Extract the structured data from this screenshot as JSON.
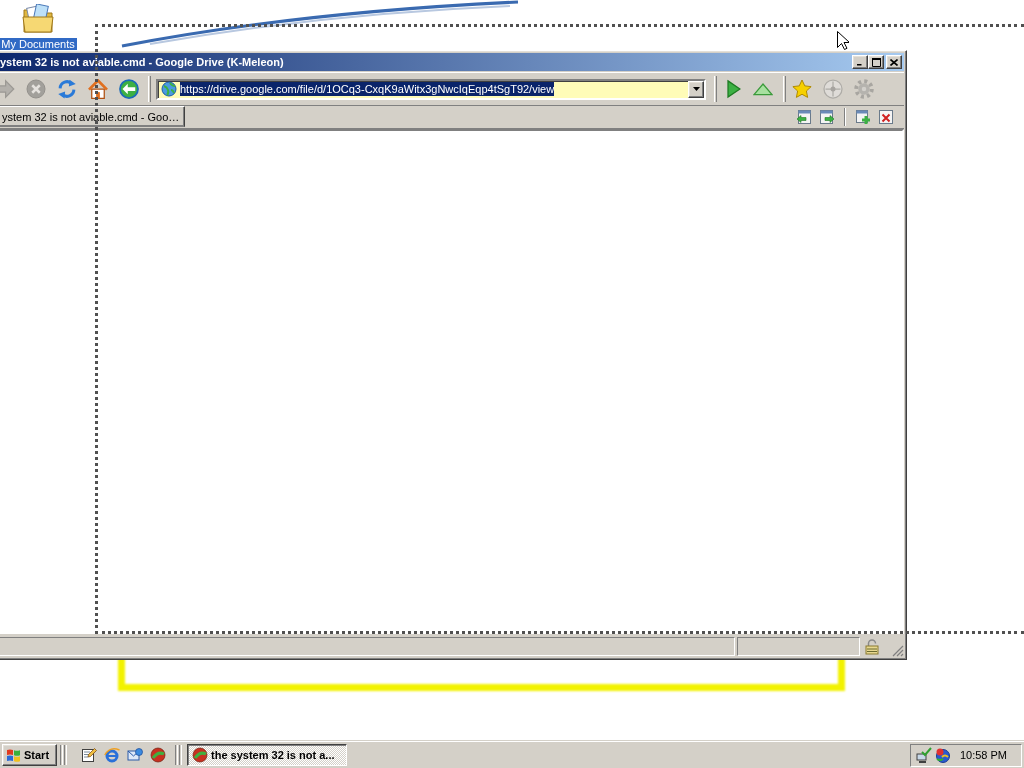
{
  "desktop": {
    "icons": [
      {
        "label": "My Documents",
        "selected": true
      }
    ]
  },
  "browser": {
    "title": "ystem 32 is not aviable.cmd - Google Drive (K-Meleon)",
    "nav_buttons": [
      {
        "kind": "arrow",
        "disabled": true
      },
      {
        "kind": "stop",
        "disabled": true
      },
      {
        "kind": "reload",
        "disabled": false
      },
      {
        "kind": "home",
        "disabled": false
      },
      {
        "kind": "circle-arrow",
        "disabled": false
      }
    ],
    "address": {
      "value": "https://drive.google.com/file/d/1OCq3-CxqK9aWitx3gNwcIqEqp4tSgT92/view",
      "selected": true
    },
    "action_buttons": [
      {
        "kind": "play",
        "disabled": false
      },
      {
        "kind": "up",
        "disabled": false
      },
      {
        "kind": "star",
        "disabled": false
      },
      {
        "kind": "compass",
        "disabled": true
      },
      {
        "kind": "gear",
        "disabled": true
      }
    ],
    "tabs": [
      {
        "label": "ystem 32 is not aviable.cmd - Goo…",
        "selected": true
      }
    ],
    "tab_buttons": [
      {
        "kind": "page-left"
      },
      {
        "kind": "page-right"
      },
      {
        "kind": "page-plus"
      },
      {
        "kind": "close"
      }
    ]
  },
  "taskbar": {
    "start": "Start",
    "quick_launch": [
      {
        "kind": "notepad"
      },
      {
        "kind": "ring"
      },
      {
        "kind": "envelope"
      },
      {
        "kind": "ball"
      }
    ],
    "tasks": [
      {
        "label": "the system 32 is not a...",
        "selected": true
      }
    ],
    "clock": "10:58 PM"
  }
}
